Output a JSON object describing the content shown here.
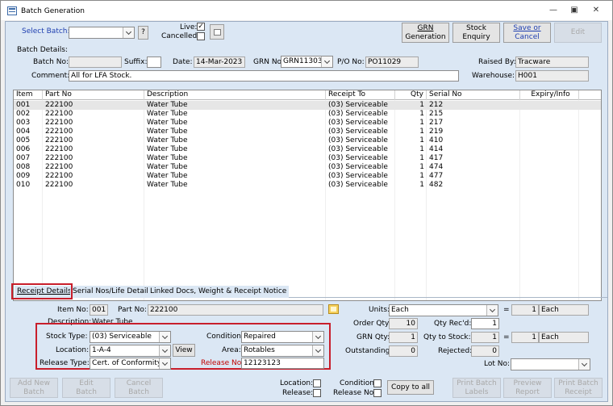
{
  "window": {
    "title": "Batch Generation",
    "controls": {
      "minimize": "—",
      "restore": "▣",
      "close": "✕"
    }
  },
  "header": {
    "select_batch_label": "Select Batch:",
    "select_batch_value": "",
    "help_label": "?",
    "live_label": "Live:",
    "live_checked": "✓",
    "cancelled_label": "Cancelled:",
    "cancelled_checked": ""
  },
  "toolbar": {
    "grn_generation": [
      "GRN",
      "Generation"
    ],
    "stock_enquiry": [
      "Stock",
      "Enquiry"
    ],
    "save_cancel": [
      "Save or",
      "Cancel"
    ],
    "edit": "Edit"
  },
  "batch_details": {
    "section_label": "Batch Details:",
    "batch_no_label": "Batch No:",
    "batch_no": "",
    "suffix_label": "Suffix:",
    "suffix": "",
    "date_label": "Date:",
    "date": "14-Mar-2023",
    "grn_no_label": "GRN No:",
    "grn_no": "GRN11303",
    "po_no_label": "P/O No:",
    "po_no": "PO11029",
    "raised_by_label": "Raised By:",
    "raised_by": "Tracware",
    "comment_label": "Comment:",
    "comment": "All for LFA Stock.",
    "warehouse_label": "Warehouse:",
    "warehouse": "H001"
  },
  "grid": {
    "columns": [
      "Item",
      "Part No",
      "Description",
      "Receipt To",
      "Qty",
      "Serial No",
      "Expiry/Info"
    ],
    "rows": [
      [
        "001",
        "222100",
        "Water Tube",
        "(03) Serviceable",
        "1",
        "212"
      ],
      [
        "002",
        "222100",
        "Water Tube",
        "(03) Serviceable",
        "1",
        "215"
      ],
      [
        "003",
        "222100",
        "Water Tube",
        "(03) Serviceable",
        "1",
        "217"
      ],
      [
        "004",
        "222100",
        "Water Tube",
        "(03) Serviceable",
        "1",
        "219"
      ],
      [
        "005",
        "222100",
        "Water Tube",
        "(03) Serviceable",
        "1",
        "410"
      ],
      [
        "006",
        "222100",
        "Water Tube",
        "(03) Serviceable",
        "1",
        "414"
      ],
      [
        "007",
        "222100",
        "Water Tube",
        "(03) Serviceable",
        "1",
        "417"
      ],
      [
        "008",
        "222100",
        "Water Tube",
        "(03) Serviceable",
        "1",
        "474"
      ],
      [
        "009",
        "222100",
        "Water Tube",
        "(03) Serviceable",
        "1",
        "477"
      ],
      [
        "010",
        "222100",
        "Water Tube",
        "(03) Serviceable",
        "1",
        "482"
      ]
    ]
  },
  "tabs": [
    "Receipt Details",
    "Serial Nos/Life Details",
    "Linked Docs, Weight & Receipt Notice"
  ],
  "receipt": {
    "item_no_label": "Item No:",
    "item_no": "001",
    "part_no_label": "Part No:",
    "part_no": "222100",
    "description_label": "Description:",
    "description": "Water Tube",
    "stock_type_label": "Stock Type:",
    "stock_type": "(03) Serviceable",
    "condition_label": "Condition:",
    "condition": "Repaired",
    "location_label": "Location:",
    "location": "1-A-4",
    "view_label": "View",
    "area_label": "Area:",
    "area": "Rotables",
    "release_type_label": "Release Type:",
    "release_type": "Cert. of Conformity",
    "release_no_label": "Release No:",
    "release_no": "12123123",
    "units_label": "Units:",
    "units": "Each",
    "units_eq": "=",
    "units_qty": "1",
    "units_each": "Each",
    "order_qty_label": "Order Qty:",
    "order_qty": "10",
    "qty_recd_label": "Qty Rec'd:",
    "qty_recd": "1",
    "grn_qty_label": "GRN Qty:",
    "grn_qty": "1",
    "qty_to_stock_label": "Qty to Stock:",
    "qty_to_stock": "1",
    "stock_eq": "=",
    "stock_qty": "1",
    "stock_each": "Each",
    "outstanding_label": "Outstanding:",
    "outstanding": "0",
    "rejected_label": "Rejected:",
    "rejected": "0",
    "lot_no_label": "Lot No:",
    "lot_no": ""
  },
  "footer": {
    "add_new_batch": [
      "Add New",
      "Batch"
    ],
    "edit_batch": [
      "Edit",
      "Batch"
    ],
    "cancel_batch": [
      "Cancel",
      "Batch"
    ],
    "location_label": "Location:",
    "release_label": "Release:",
    "condition_label": "Condition:",
    "release_no_label": "Release No:",
    "copy_to_all": "Copy to all",
    "print_batch_labels": [
      "Print Batch",
      "Labels"
    ],
    "preview_report": [
      "Preview",
      "Report"
    ],
    "print_batch_receipt": [
      "Print Batch",
      "Receipt"
    ]
  },
  "colors": {
    "panel": "#dbe7f4",
    "accent_label": "#1f3fb0",
    "highlight_box": "#c81e2b"
  }
}
